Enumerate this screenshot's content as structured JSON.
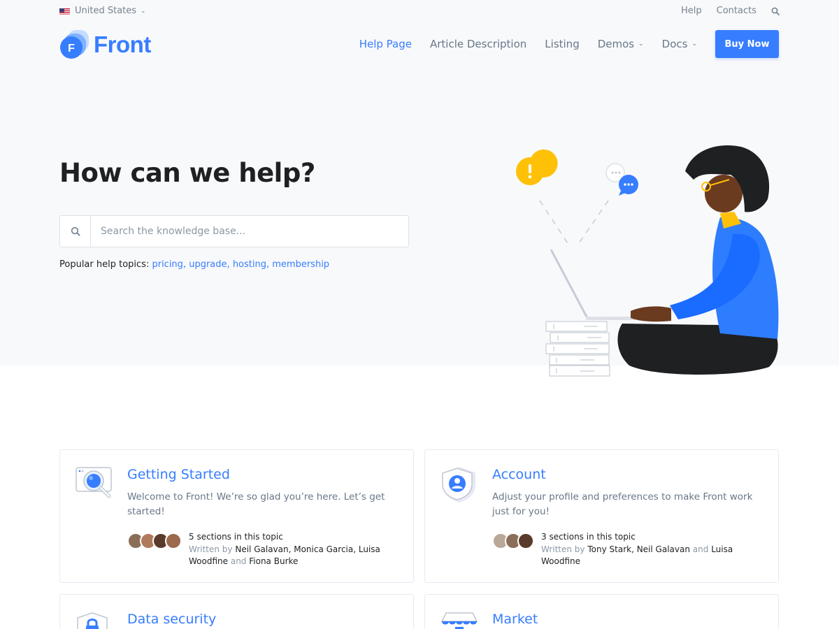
{
  "topbar": {
    "locale": "United States",
    "links": [
      "Help",
      "Contacts"
    ]
  },
  "brand": {
    "name": "Front",
    "mark_letter": "F"
  },
  "nav": {
    "items": [
      {
        "label": "Help Page",
        "active": true
      },
      {
        "label": "Article Description"
      },
      {
        "label": "Listing"
      },
      {
        "label": "Demos",
        "dropdown": true
      },
      {
        "label": "Docs",
        "dropdown": true
      }
    ],
    "cta": "Buy Now"
  },
  "hero": {
    "title": "How can we help?",
    "search_placeholder": "Search the knowledge base...",
    "popular_label": "Popular help topics:",
    "topics": [
      "pricing",
      "upgrade",
      "hosting",
      "membership"
    ]
  },
  "cards": [
    {
      "title": "Getting Started",
      "icon": "magnifier-card-icon",
      "description": "Welcome to Front! We’re so glad you’re here. Let’s get started!",
      "sections": "5 sections in this topic",
      "written_by": "Written by",
      "authors_1": "Neil Galavan, Monica Garcia, Luisa Woodfine",
      "and": "and",
      "authors_2": "Fiona Burke"
    },
    {
      "title": "Account",
      "icon": "user-shield-icon",
      "description": "Adjust your profile and preferences to make Front work just for you!",
      "sections": "3 sections in this topic",
      "written_by": "Written by",
      "authors_1": "Tony Stark, Neil Galavan",
      "and": "and",
      "authors_2": "Luisa Woodfine"
    },
    {
      "title": "Data security",
      "icon": "lock-shield-icon"
    },
    {
      "title": "Market",
      "icon": "store-icon"
    }
  ],
  "colors": {
    "primary": "#377dff",
    "hero_bg": "#f8f9fb",
    "text": "#1e2022",
    "muted": "#677788",
    "warning": "#ffc107"
  }
}
